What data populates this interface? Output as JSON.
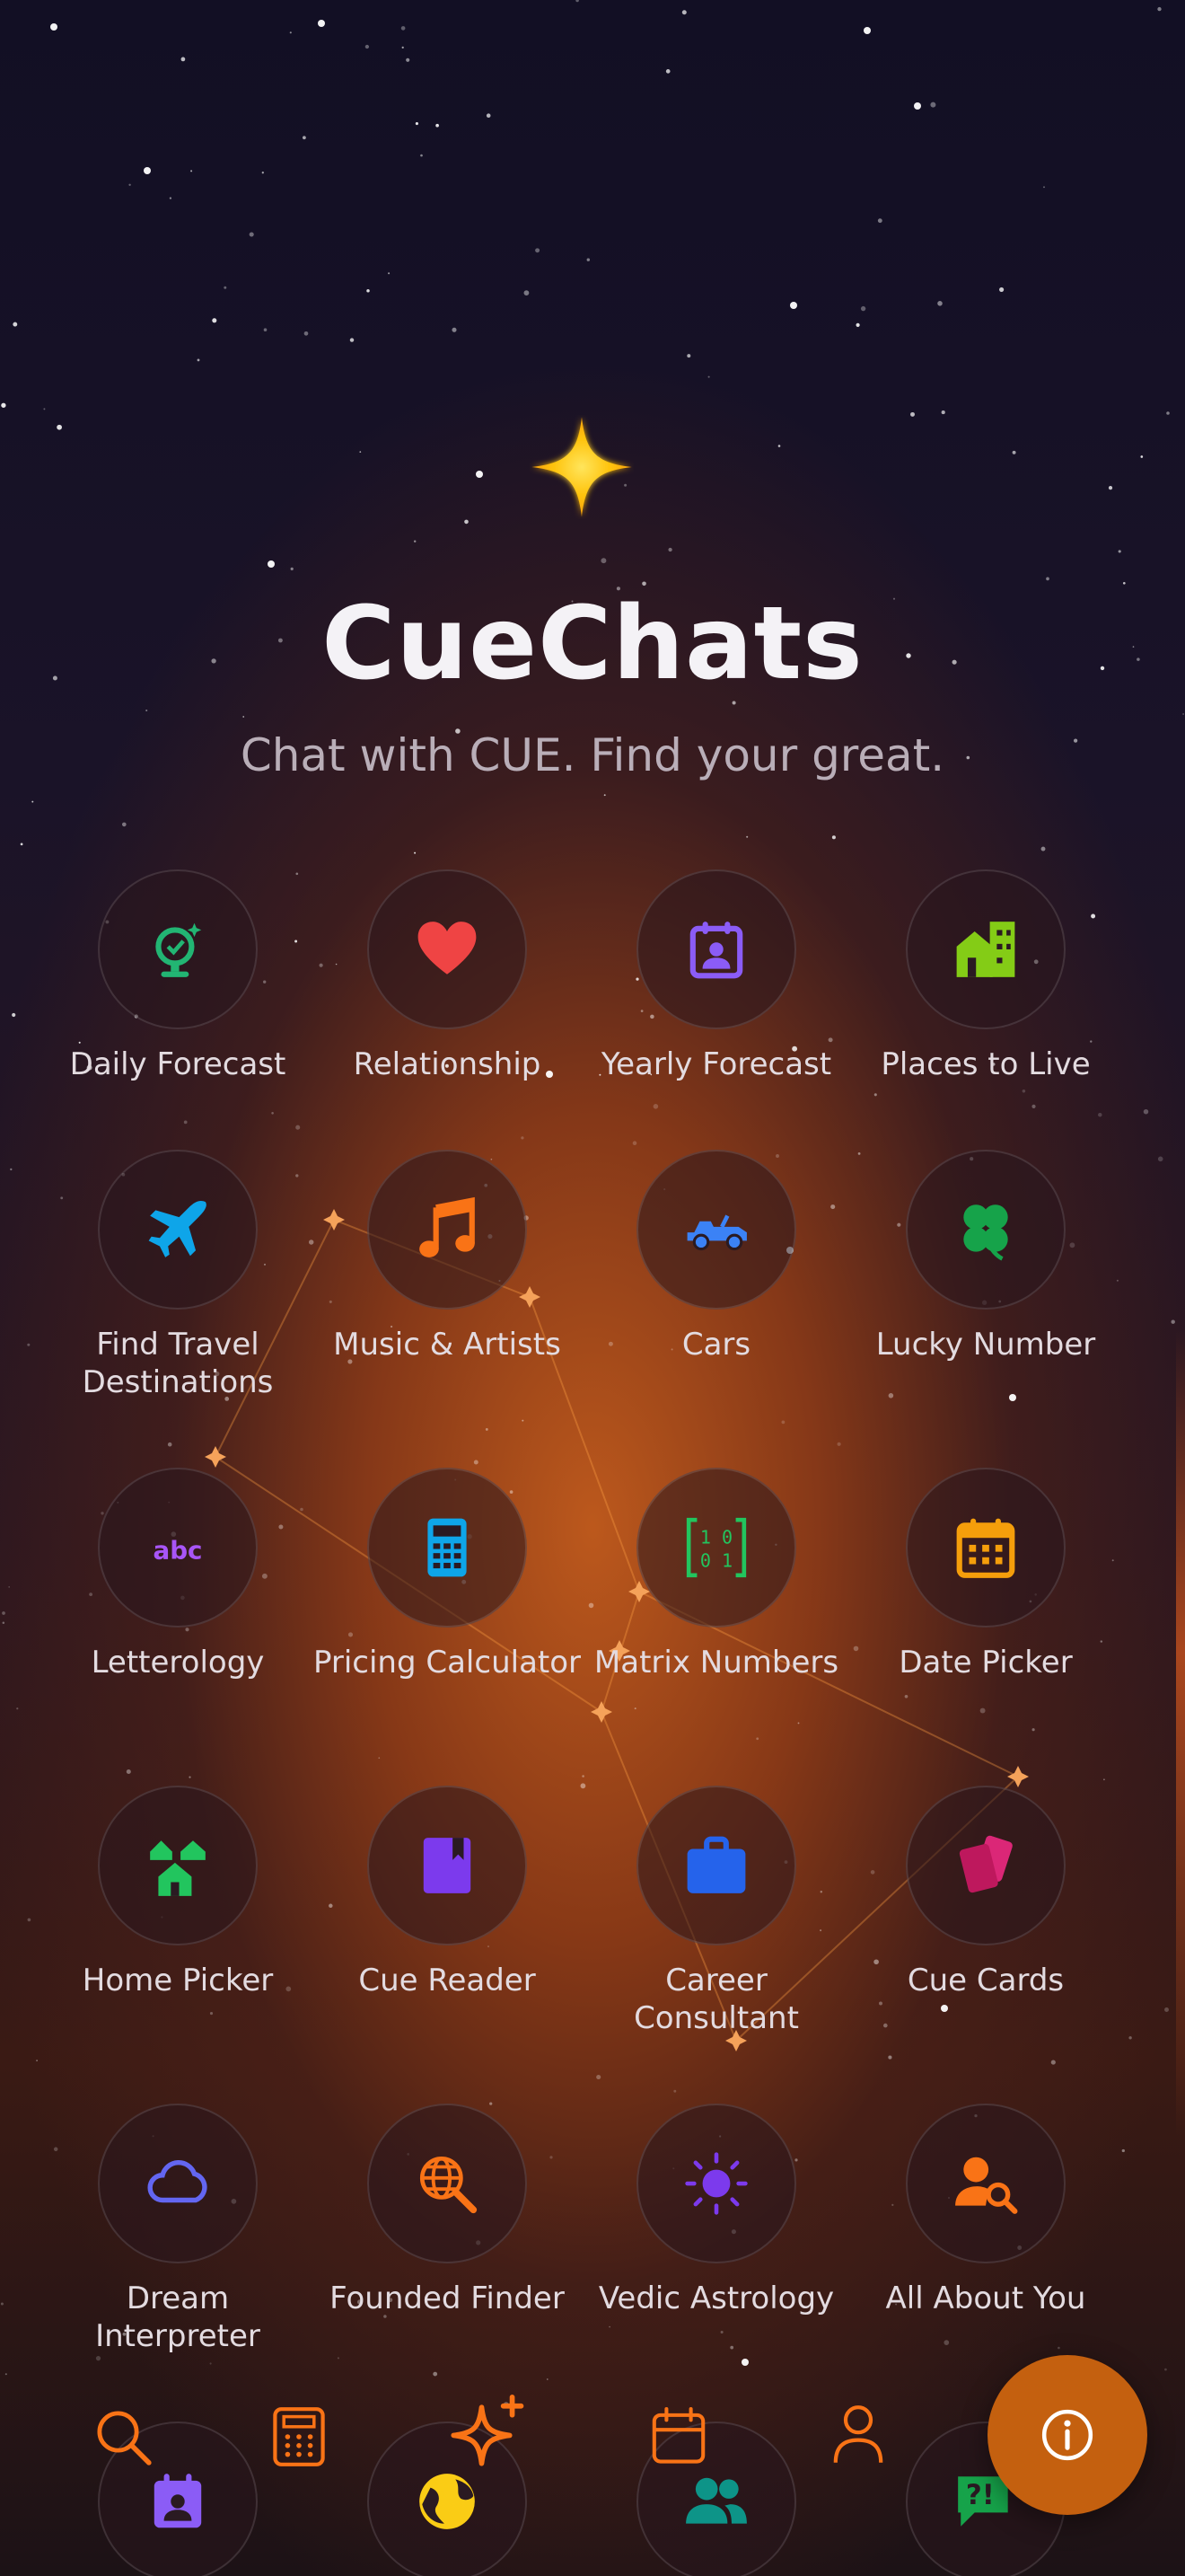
{
  "app": {
    "title": "CueChats",
    "tagline": "Chat with CUE. Find your great."
  },
  "features": [
    {
      "label": "Daily Forecast",
      "icon": "daily-forecast-icon",
      "color": "#22b573"
    },
    {
      "label": "Relationship",
      "icon": "heart-icon",
      "color": "#ef4444"
    },
    {
      "label": "Yearly Forecast",
      "icon": "calendar-person-icon",
      "color": "#8b5cf6"
    },
    {
      "label": "Places to Live",
      "icon": "buildings-icon",
      "color": "#84cc16"
    },
    {
      "label": "Find Travel Destinations",
      "icon": "airplane-icon",
      "color": "#0ea5e9"
    },
    {
      "label": "Music & Artists",
      "icon": "music-note-icon",
      "color": "#f97316"
    },
    {
      "label": "Cars",
      "icon": "car-icon",
      "color": "#3b82f6"
    },
    {
      "label": "Lucky Number",
      "icon": "clover-icon",
      "color": "#16a34a"
    },
    {
      "label": "Letterology",
      "icon": "abc-icon",
      "color": "#a855f7"
    },
    {
      "label": "Pricing Calculator",
      "icon": "calculator-icon",
      "color": "#0ea5e9"
    },
    {
      "label": "Matrix Numbers",
      "icon": "matrix-icon",
      "color": "#22c55e"
    },
    {
      "label": "Date Picker",
      "icon": "calendar-grid-icon",
      "color": "#f59e0b"
    },
    {
      "label": "Home Picker",
      "icon": "homes-icon",
      "color": "#22c55e"
    },
    {
      "label": "Cue Reader",
      "icon": "book-icon",
      "color": "#7c3aed"
    },
    {
      "label": "Career Consultant",
      "icon": "briefcase-icon",
      "color": "#2563eb"
    },
    {
      "label": "Cue Cards",
      "icon": "cards-icon",
      "color": "#db2777"
    },
    {
      "label": "Dream Interpreter",
      "icon": "cloud-icon",
      "color": "#6366f1"
    },
    {
      "label": "Founded Finder",
      "icon": "globe-search-icon",
      "color": "#f97316"
    },
    {
      "label": "Vedic Astrology",
      "icon": "sun-icon",
      "color": "#7c3aed"
    },
    {
      "label": "All About You",
      "icon": "person-search-icon",
      "color": "#f97316"
    }
  ],
  "partial_row_icons": [
    {
      "icon": "calendar-person-icon",
      "color": "#8b5cf6"
    },
    {
      "icon": "globe-icon",
      "color": "#facc15"
    },
    {
      "icon": "people-icon",
      "color": "#0d9488"
    },
    {
      "icon": "question-chat-icon",
      "color": "#16a34a"
    }
  ],
  "bottom_nav": [
    {
      "icon": "search-icon"
    },
    {
      "icon": "calculator-icon"
    },
    {
      "icon": "sparkles-icon"
    },
    {
      "icon": "calendar-icon"
    },
    {
      "icon": "profile-icon"
    }
  ],
  "fab": {
    "icon": "info-icon"
  },
  "colors": {
    "accent": "#f97316",
    "fab": "#c4600f",
    "logo": "#ffc107"
  }
}
